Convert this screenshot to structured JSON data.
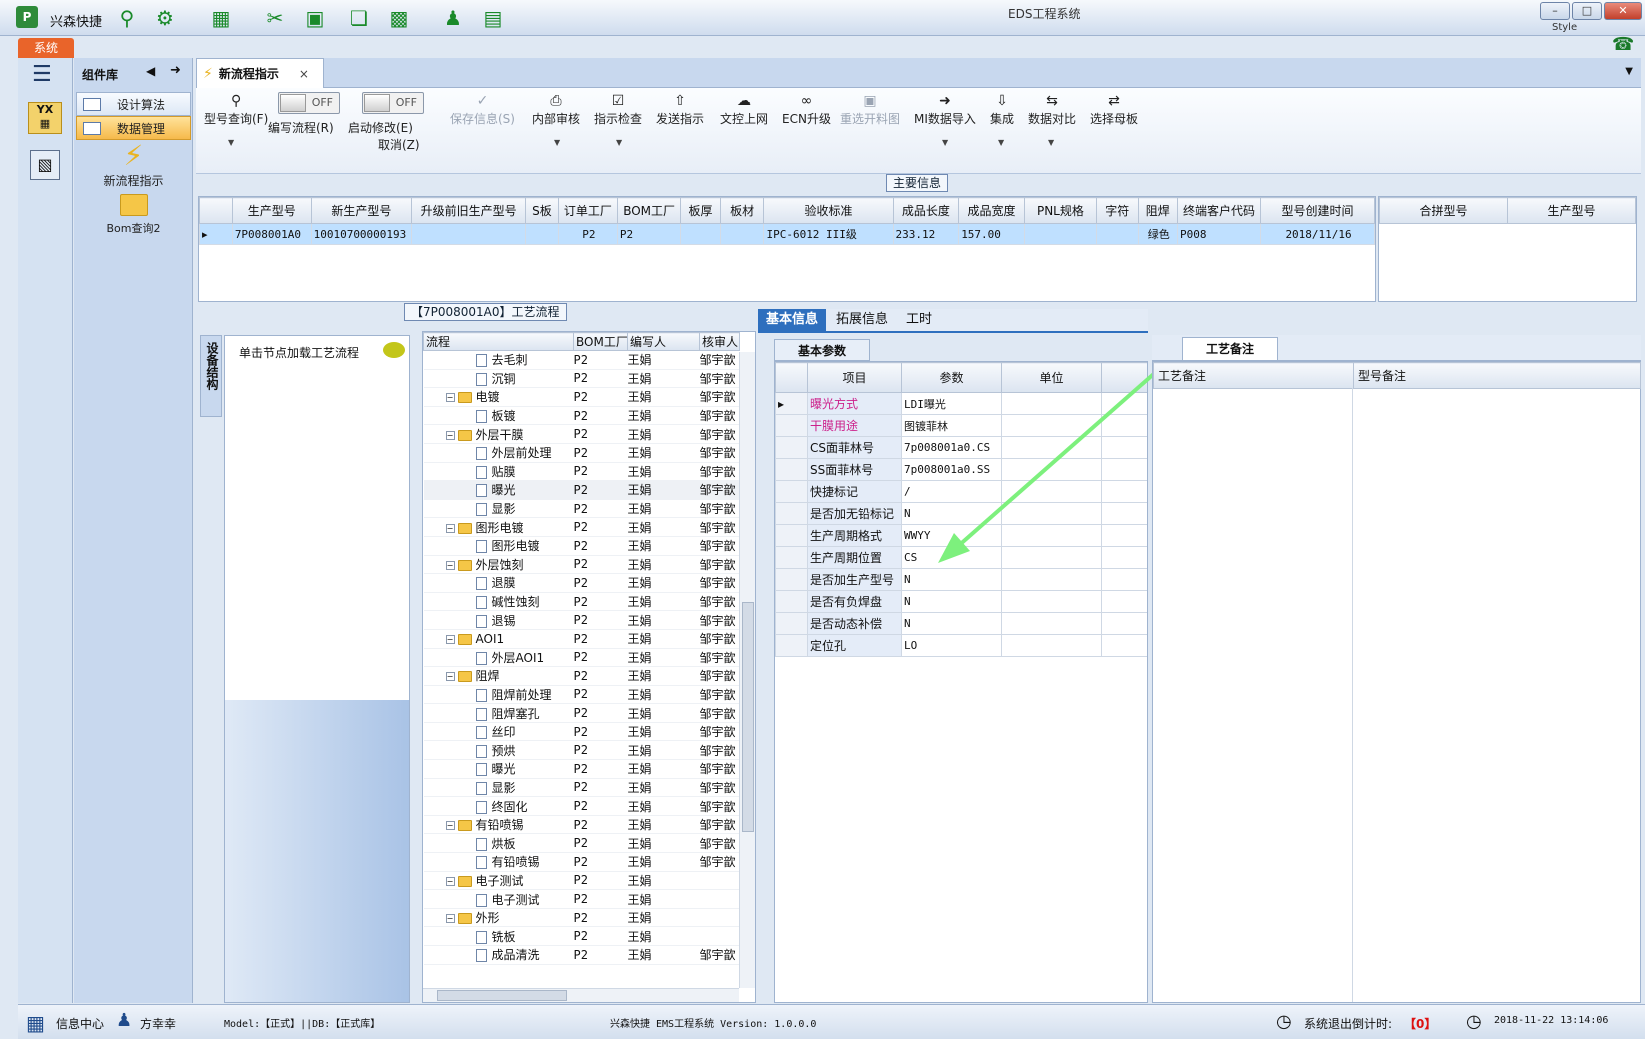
{
  "window": {
    "app_name": "兴森快捷",
    "title": "EDS工程系统",
    "style_label": "Style"
  },
  "menu": {
    "system_tab": "系统"
  },
  "left_panel": {
    "header": "组件库",
    "items": [
      {
        "label": "设计算法"
      },
      {
        "label": "数据管理"
      }
    ],
    "launchers": [
      {
        "label": "新流程指示"
      },
      {
        "label": "Bom查询2"
      }
    ]
  },
  "doc_tab": {
    "label": "新流程指示"
  },
  "toolbar": {
    "model_query": "型号查询(F)",
    "edit_flow_toggle": "OFF",
    "edit_flow_label": "编写流程(R)",
    "enable_edit_toggle": "OFF",
    "enable_edit_label": "启动修改(E)",
    "cancel_label": "取消(Z)",
    "save_info": "保存信息(S)",
    "internal_review": "内部审核",
    "instruction_check": "指示检查",
    "send_instruction": "发送指示",
    "upload": "文控上网",
    "ecn_upgrade": "ECN升级",
    "reselect_drawing": "重选开料图",
    "mi_import": "MI数据导入",
    "integrate": "集成",
    "data_compare": "数据对比",
    "select_master": "选择母板"
  },
  "main_info": {
    "section_label": "主要信息",
    "columns": [
      "生产型号",
      "新生产型号",
      "升级前旧生产型号",
      "S板",
      "订单工厂",
      "BOM工厂",
      "板厚",
      "板材",
      "验收标准",
      "成品长度",
      "成品宽度",
      "PNL规格",
      "字符",
      "阻焊",
      "终端客户代码",
      "型号创建时间"
    ],
    "row": [
      "7P008001A0",
      "10010700000193",
      "",
      "",
      "P2",
      "P2",
      "",
      "",
      "IPC-6012 III级",
      "233.12",
      "157.00",
      "",
      "",
      "绿色",
      "P008",
      "2018/11/16"
    ],
    "side_columns": [
      "合拼型号",
      "生产型号"
    ]
  },
  "flow": {
    "section_label": "【7P008001A0】工艺流程",
    "side_tab": "设备结构",
    "hint": "单击节点加载工艺流程",
    "columns": [
      "流程",
      "BOM工厂",
      "编写人",
      "核审人"
    ],
    "rows": [
      {
        "name": "去毛刺",
        "type": "leaf",
        "bom": "P2",
        "writer": "王娟",
        "reviewer": "邹宇歆"
      },
      {
        "name": "沉铜",
        "type": "leaf",
        "bom": "P2",
        "writer": "王娟",
        "reviewer": "邹宇歆"
      },
      {
        "name": "电镀",
        "type": "folder",
        "bom": "P2",
        "writer": "王娟",
        "reviewer": "邹宇歆"
      },
      {
        "name": "板镀",
        "type": "leaf",
        "bom": "P2",
        "writer": "王娟",
        "reviewer": "邹宇歆"
      },
      {
        "name": "外层干膜",
        "type": "folder",
        "bom": "P2",
        "writer": "王娟",
        "reviewer": "邹宇歆"
      },
      {
        "name": "外层前处理",
        "type": "leaf",
        "bom": "P2",
        "writer": "王娟",
        "reviewer": "邹宇歆"
      },
      {
        "name": "贴膜",
        "type": "leaf",
        "bom": "P2",
        "writer": "王娟",
        "reviewer": "邹宇歆"
      },
      {
        "name": "曝光",
        "type": "leaf",
        "bom": "P2",
        "writer": "王娟",
        "reviewer": "邹宇歆"
      },
      {
        "name": "显影",
        "type": "leaf",
        "bom": "P2",
        "writer": "王娟",
        "reviewer": "邹宇歆"
      },
      {
        "name": "图形电镀",
        "type": "folder",
        "bom": "P2",
        "writer": "王娟",
        "reviewer": "邹宇歆"
      },
      {
        "name": "图形电镀",
        "type": "leaf",
        "bom": "P2",
        "writer": "王娟",
        "reviewer": "邹宇歆"
      },
      {
        "name": "外层蚀刻",
        "type": "folder",
        "bom": "P2",
        "writer": "王娟",
        "reviewer": "邹宇歆"
      },
      {
        "name": "退膜",
        "type": "leaf",
        "bom": "P2",
        "writer": "王娟",
        "reviewer": "邹宇歆"
      },
      {
        "name": "碱性蚀刻",
        "type": "leaf",
        "bom": "P2",
        "writer": "王娟",
        "reviewer": "邹宇歆"
      },
      {
        "name": "退锡",
        "type": "leaf",
        "bom": "P2",
        "writer": "王娟",
        "reviewer": "邹宇歆"
      },
      {
        "name": "AOI1",
        "type": "folder",
        "bom": "P2",
        "writer": "王娟",
        "reviewer": "邹宇歆"
      },
      {
        "name": "外层AOI1",
        "type": "leaf",
        "bom": "P2",
        "writer": "王娟",
        "reviewer": "邹宇歆"
      },
      {
        "name": "阻焊",
        "type": "folder",
        "bom": "P2",
        "writer": "王娟",
        "reviewer": "邹宇歆"
      },
      {
        "name": "阻焊前处理",
        "type": "leaf",
        "bom": "P2",
        "writer": "王娟",
        "reviewer": "邹宇歆"
      },
      {
        "name": "阻焊塞孔",
        "type": "leaf",
        "bom": "P2",
        "writer": "王娟",
        "reviewer": "邹宇歆"
      },
      {
        "name": "丝印",
        "type": "leaf",
        "bom": "P2",
        "writer": "王娟",
        "reviewer": "邹宇歆"
      },
      {
        "name": "预烘",
        "type": "leaf",
        "bom": "P2",
        "writer": "王娟",
        "reviewer": "邹宇歆"
      },
      {
        "name": "曝光",
        "type": "leaf",
        "bom": "P2",
        "writer": "王娟",
        "reviewer": "邹宇歆"
      },
      {
        "name": "显影",
        "type": "leaf",
        "bom": "P2",
        "writer": "王娟",
        "reviewer": "邹宇歆"
      },
      {
        "name": "终固化",
        "type": "leaf",
        "bom": "P2",
        "writer": "王娟",
        "reviewer": "邹宇歆"
      },
      {
        "name": "有铅喷锡",
        "type": "folder",
        "bom": "P2",
        "writer": "王娟",
        "reviewer": "邹宇歆"
      },
      {
        "name": "烘板",
        "type": "leaf",
        "bom": "P2",
        "writer": "王娟",
        "reviewer": "邹宇歆"
      },
      {
        "name": "有铅喷锡",
        "type": "leaf",
        "bom": "P2",
        "writer": "王娟",
        "reviewer": "邹宇歆"
      },
      {
        "name": "电子测试",
        "type": "folder",
        "bom": "P2",
        "writer": "王娟",
        "reviewer": ""
      },
      {
        "name": "电子测试",
        "type": "leaf",
        "bom": "P2",
        "writer": "王娟",
        "reviewer": ""
      },
      {
        "name": "外形",
        "type": "folder",
        "bom": "P2",
        "writer": "王娟",
        "reviewer": ""
      },
      {
        "name": "铣板",
        "type": "leaf",
        "bom": "P2",
        "writer": "王娟",
        "reviewer": ""
      },
      {
        "name": "成品清洗",
        "type": "leaf",
        "bom": "P2",
        "writer": "王娟",
        "reviewer": "邹宇歆"
      }
    ]
  },
  "details": {
    "tabs": [
      "基本信息",
      "拓展信息",
      "工时"
    ],
    "basic_label": "基本参数",
    "columns": [
      "项目",
      "参数",
      "单位"
    ],
    "rows": [
      {
        "item": "曝光方式",
        "value": "LDI曝光",
        "unit": "",
        "highlight": true
      },
      {
        "item": "干膜用途",
        "value": "图镀菲林",
        "unit": "",
        "highlight": true
      },
      {
        "item": "CS面菲林号",
        "value": "7p008001a0.CS",
        "unit": "",
        "highlight": false
      },
      {
        "item": "SS面菲林号",
        "value": "7p008001a0.SS",
        "unit": "",
        "highlight": false
      },
      {
        "item": "快捷标记",
        "value": "/",
        "unit": "",
        "highlight": false
      },
      {
        "item": "是否加无铅标记",
        "value": "N",
        "unit": "",
        "highlight": false
      },
      {
        "item": "生产周期格式",
        "value": "WWYY",
        "unit": "",
        "highlight": false
      },
      {
        "item": "生产周期位置",
        "value": "CS",
        "unit": "",
        "highlight": false
      },
      {
        "item": "是否加生产型号",
        "value": "N",
        "unit": "",
        "highlight": false
      },
      {
        "item": "是否有负焊盘",
        "value": "N",
        "unit": "",
        "highlight": false
      },
      {
        "item": "是否动态补偿",
        "value": "N",
        "unit": "",
        "highlight": false
      },
      {
        "item": "定位孔",
        "value": "LO",
        "unit": "",
        "highlight": false
      }
    ]
  },
  "notes": {
    "tab": "工艺备注",
    "columns": [
      "工艺备注",
      "型号备注"
    ]
  },
  "status": {
    "info_center": "信息中心",
    "user": "方幸幸",
    "model_db": "Model:【正式】||DB:【正式库】",
    "version": "兴森快捷 EMS工程系统 Version: 1.0.0.0",
    "logout_label": "系统退出倒计时:",
    "logout_count": "【0】",
    "datetime": "2018-11-22 13:14:06"
  },
  "colors": {
    "accent": "#2e6fbe",
    "highlight_text": "#cc1f8a",
    "arrow": "#7df07d",
    "orange_tab": "#e9642a"
  }
}
